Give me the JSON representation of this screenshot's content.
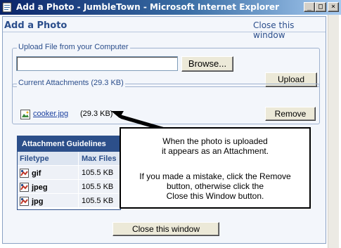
{
  "window": {
    "title": "Add a Photo - JumbleTown - Microsoft Internet Explorer",
    "minimize_glyph": "_",
    "maximize_glyph": "□",
    "close_glyph": "×"
  },
  "popup": {
    "title": "Add a Photo",
    "close_link": "Close this window"
  },
  "upload": {
    "legend": "Upload File from your Computer",
    "file_value": "",
    "browse_label": "Browse...",
    "upload_label": "Upload"
  },
  "attachments": {
    "legend": "Current Attachments (29.3 KB)",
    "items": [
      {
        "name": "cooker.jpg",
        "size": "(29.3 KB)"
      }
    ],
    "remove_label": "Remove"
  },
  "guidelines": {
    "title": "Attachment Guidelines",
    "columns": [
      "Filetype",
      "Max Files"
    ],
    "rows": [
      {
        "type": "gif",
        "max": "105.5 KB"
      },
      {
        "type": "jpeg",
        "max": "105.5 KB"
      },
      {
        "type": "jpg",
        "max": "105.5 KB"
      }
    ]
  },
  "callout": {
    "line1": "When the photo is uploaded",
    "line2": "it appears as an Attachment.",
    "line3": "If you made a mistake,  click the Remove",
    "line4": "button, otherwise click the",
    "line5": "Close this Window button."
  },
  "footer": {
    "close_button": "Close this window"
  },
  "colors": {
    "accent": "#2c4f8a",
    "titlebar": "#0a246a",
    "link": "#1a3f9e"
  }
}
